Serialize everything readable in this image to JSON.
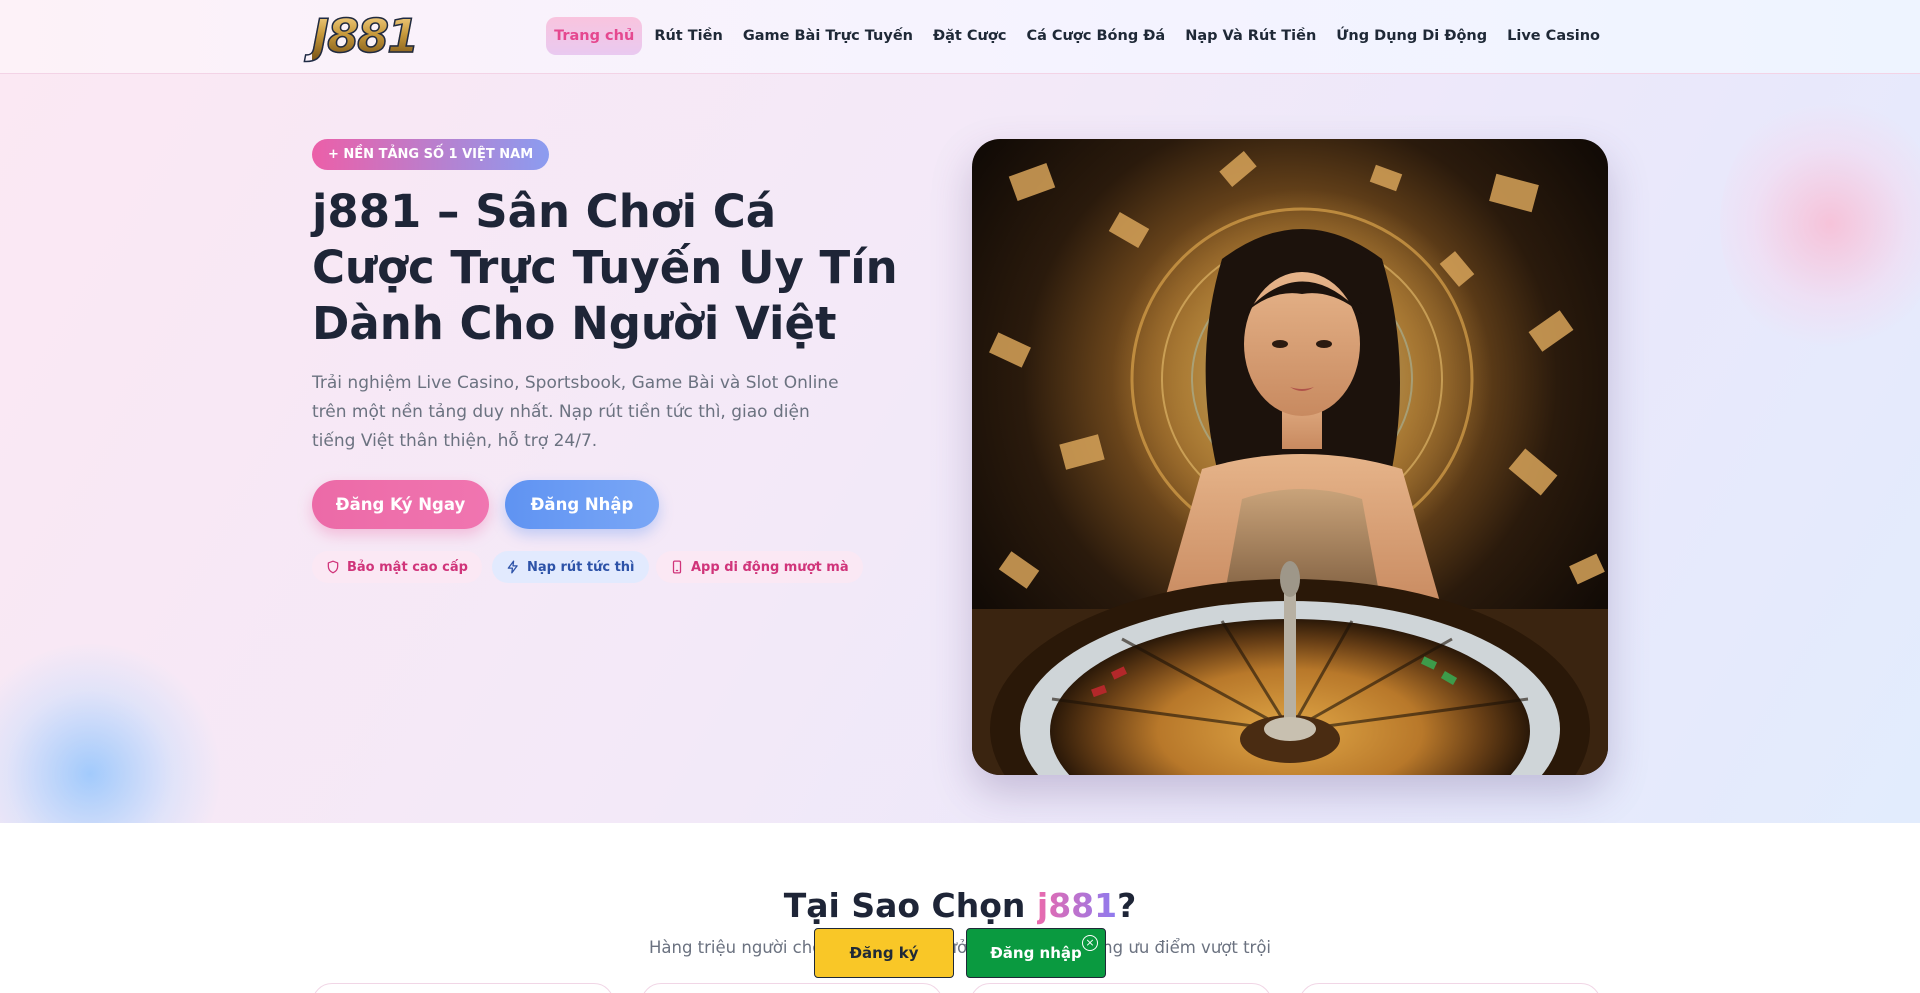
{
  "header": {
    "logo_text": "J881",
    "nav": [
      {
        "label": "Trang chủ",
        "active": true
      },
      {
        "label": "Rút Tiền"
      },
      {
        "label": "Game Bài Trực Tuyến"
      },
      {
        "label": "Đặt Cược"
      },
      {
        "label": "Cá Cược Bóng Đá"
      },
      {
        "label": "Nạp Và Rút Tiền"
      },
      {
        "label": "Ứng Dụng Di Động"
      },
      {
        "label": "Live Casino"
      }
    ]
  },
  "hero": {
    "badge": "+ NỀN TẢNG SỐ 1 VIỆT NAM",
    "title": "j881 – Sân Chơi Cá Cược Trực Tuyến Uy Tín Dành Cho Người Việt",
    "description": "Trải nghiệm Live Casino, Sportsbook, Game Bài và Slot Online trên một nền tảng duy nhất. Nạp rút tiền tức thì, giao diện tiếng Việt thân thiện, hỗ trợ 24/7.",
    "register_button": "Đăng Ký Ngay",
    "login_button": "Đăng Nhập",
    "features": [
      {
        "label": "Bảo mật cao cấp",
        "icon": "shield-icon"
      },
      {
        "label": "Nạp rút tức thì",
        "icon": "lightning-icon"
      },
      {
        "label": "App di động mượt mà",
        "icon": "phone-icon"
      }
    ]
  },
  "why": {
    "title_prefix": "Tại Sao Chọn ",
    "title_accent": "j881",
    "title_suffix": "?",
    "subtitle": "Hàng triệu người chơi Việt Nam tin tưởng j881 nhờ những ưu điểm vượt trội"
  },
  "floating": {
    "register": "Đăng ký",
    "login": "Đăng nhập",
    "close": "×"
  },
  "colors": {
    "accent_pink": "#ec6aa7",
    "accent_blue": "#5f93f2",
    "float_yellow": "#f9c727",
    "float_green": "#0a9a40"
  }
}
